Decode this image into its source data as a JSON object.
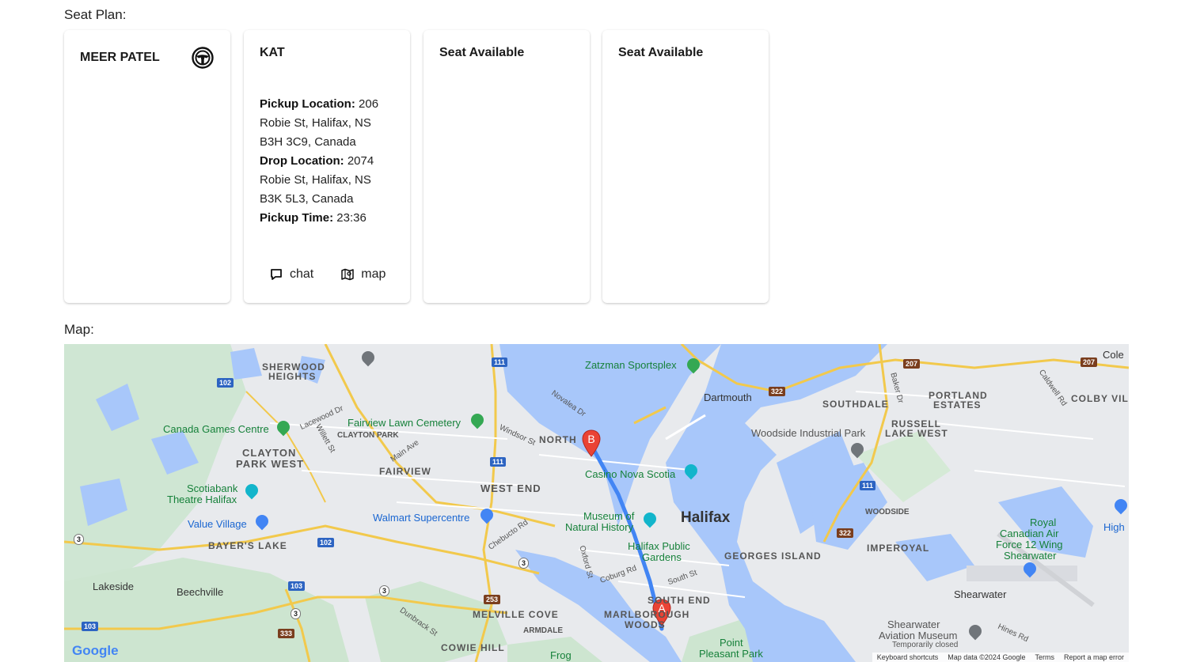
{
  "seat_plan": {
    "label": "Seat Plan:",
    "driver": {
      "name": "MEER PATEL",
      "icon": "steering-wheel-icon"
    },
    "passenger": {
      "name": "KAT",
      "pickup_location_label": "Pickup Location:",
      "pickup_location": " 206 Robie St, Halifax, NS B3H 3C9, Canada",
      "drop_location_label": "Drop Location:",
      "drop_location": " 2074 Robie St, Halifax, NS B3K 5L3, Canada",
      "pickup_time_label": "Pickup Time:",
      "pickup_time": " 23:36",
      "chat_label": "chat",
      "map_label": "map"
    },
    "seat3": "Seat Available",
    "seat4": "Seat Available"
  },
  "map": {
    "label": "Map:",
    "marker_a": "A",
    "marker_b": "B",
    "places": {
      "sherwood": "SHERWOOD",
      "heights": "HEIGHTS",
      "zatzman": "Zatzman Sportsplex",
      "dartmouth": "Dartmouth",
      "southdale": "SOUTHDALE",
      "portland": "PORTLAND",
      "estates": "ESTATES",
      "colby": "COLBY VILL",
      "cole": "Cole",
      "canada_games": "Canada Games Centre",
      "fairview_cem": "Fairview Lawn Cemetery",
      "clayton_park": "CLAYTON PARK",
      "clayton": "CLAYTON",
      "park_west": "PARK WEST",
      "north": "NORTH",
      "woodside_ind": "Woodside Industrial Park",
      "russell": "RUSSELL",
      "lake_west": "LAKE WEST",
      "fairview": "FAIRVIEW",
      "casino": "Casino Nova Scotia",
      "scotiabank": "Scotiabank",
      "theatre": "Theatre Halifax",
      "west_end": "WEST END",
      "walmart": "Walmart Supercentre",
      "museum1": "Museum of",
      "museum2": "Natural History",
      "halifax": "Halifax",
      "woodside": "WOODSIDE",
      "royal": "Royal",
      "canadian_air": "Canadian Air",
      "force12": "Force 12 Wing",
      "shearwater_base": "Shearwater",
      "high": "High",
      "value_village": "Value Village",
      "bayers_lake": "BAYER'S LAKE",
      "public_gardens1": "Halifax Public",
      "public_gardens2": "Gardens",
      "georges_island": "GEORGES ISLAND",
      "imperoyal": "IMPEROYAL",
      "lakeside": "Lakeside",
      "beechville": "Beechville",
      "south_end": "SOUTH END",
      "shearwater": "Shearwater",
      "melville": "MELVILLE COVE",
      "marlborough1": "MARLBOROUGH",
      "marlborough2": "WOODS",
      "armdale": "ARMDALE",
      "aviation1": "Shearwater",
      "aviation2": "Aviation Museum",
      "temp_closed": "Temporarily closed",
      "cowie_hill": "COWIE HILL",
      "frog": "Frog",
      "point_pleasant1": "Point",
      "point_pleasant2": "Pleasant Park"
    },
    "streets": {
      "lacewood": "Lacewood Dr",
      "willett": "Willett St",
      "main_ave": "Main Ave",
      "windsor": "Windsor St",
      "novalea": "Novalea Dr",
      "baker": "Baker Dr",
      "caldwell": "Caldwell Rd",
      "chebucto": "Chebucto Rd",
      "oxford": "Oxford St",
      "coburg": "Coburg Rd",
      "south_st": "South St",
      "dunbrack": "Dunbrack St",
      "hines": "Hines Rd"
    },
    "shields": [
      "111",
      "102",
      "111",
      "102",
      "103",
      "3",
      "3",
      "3",
      "103",
      "333",
      "253",
      "3",
      "207",
      "322",
      "207",
      "111",
      "322"
    ],
    "attribution": {
      "shortcuts": "Keyboard shortcuts",
      "data": "Map data ©2024 Google",
      "terms": "Terms",
      "report": "Report a map error"
    },
    "google_logo": "Google"
  }
}
